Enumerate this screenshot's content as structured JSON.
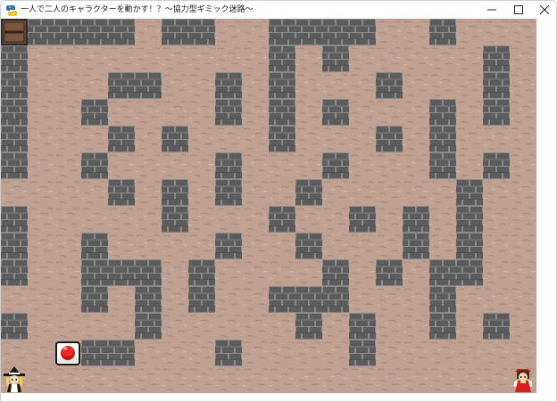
{
  "window": {
    "title": "一人で二人のキャラクターを動かす！？～協力型ギミック迷路～",
    "app_icon": "python-icon",
    "controls": {
      "minimize_icon": "minimize-icon",
      "maximize_icon": "maximize-icon",
      "close_icon": "close-icon"
    }
  },
  "game": {
    "grid": {
      "cols": 20,
      "rows": 14
    },
    "colors": {
      "floor": "#bfa091",
      "floor_speckle": "#a88a7b",
      "wall_brick": "#5c5c5c",
      "wall_mortar": "#8a8a8a",
      "wall_shadow": "#3f3f3f",
      "background": "#ffffff"
    },
    "maze_rows": [
      "#####.##..####..#...",
      "#.........#.#.....#.",
      "#...##..#.#...#...#.",
      "#..#....#.#.#...#.#.",
      "#...#.#...#...#.#...",
      "#..#....#...#...#.#.",
      "....#.#.#..#.....#..",
      "#.....#...#..#.#.#..",
      "#..#....#..#...#.#..",
      "#..###.#....#.#.##..",
      "...#.#.#..###...#...",
      "#....#.....#.#..#.#.",
      "...##...#....#......",
      "....................",
      ".##.#.##..##.#.#...."
    ],
    "objects": [
      {
        "name": "exit-door",
        "icon": "door-icon",
        "col": 0,
        "row": 0
      },
      {
        "name": "red-button-switch",
        "icon": "red-button-icon",
        "col": 2,
        "row": 12
      },
      {
        "name": "marisa-character",
        "icon": "witch-character-icon",
        "col": 0,
        "row": 13
      },
      {
        "name": "reimu-character",
        "icon": "shrine-maiden-character-icon",
        "col": 19,
        "row": 13
      }
    ]
  }
}
